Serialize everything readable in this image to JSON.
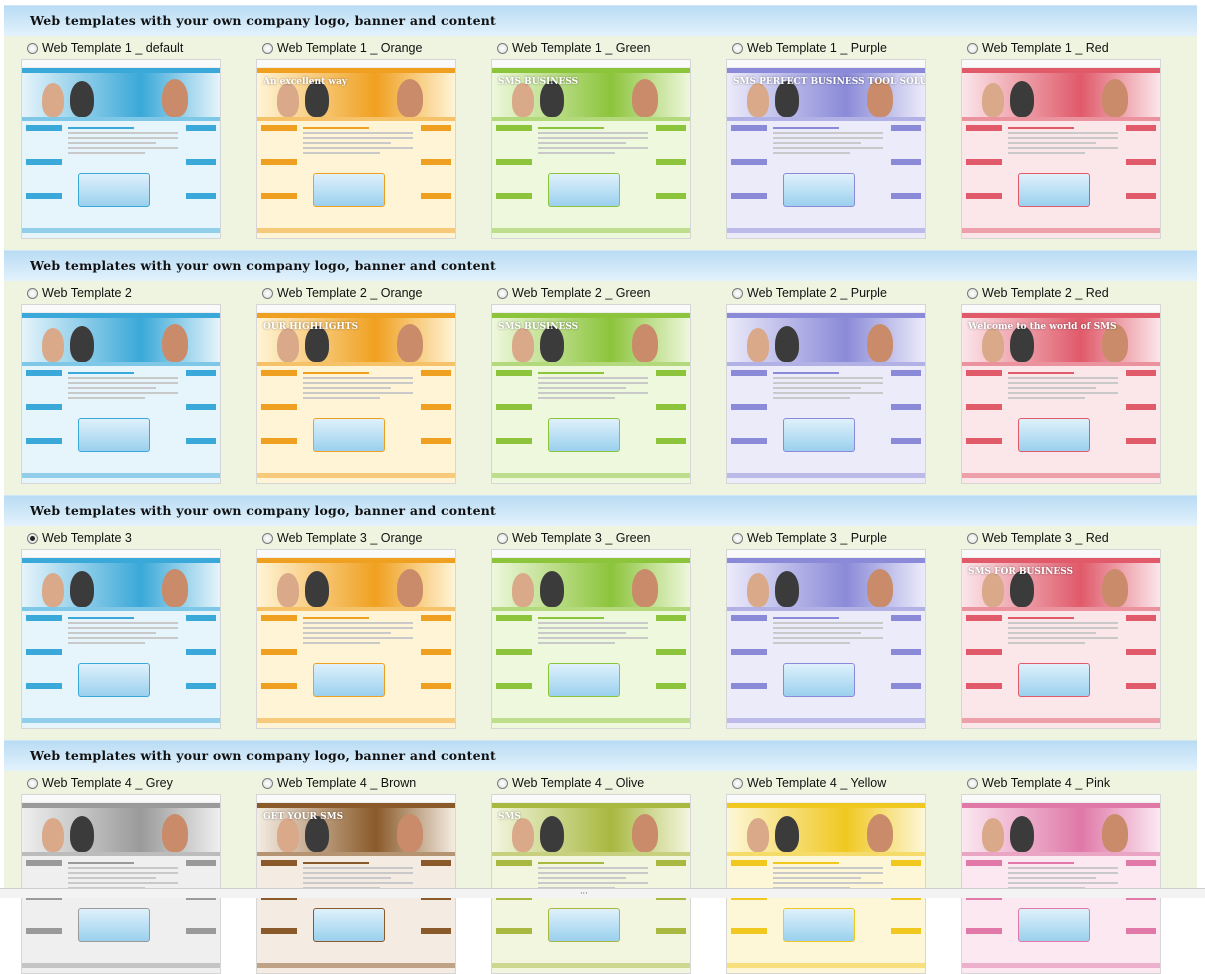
{
  "sections": [
    {
      "title": "Web templates with your own company logo, banner and content",
      "options": [
        {
          "label": "Web Template 1 _ default",
          "checked": false,
          "accent": "#3aa8d8",
          "accent2": "#e6f4fb",
          "banner_text": ""
        },
        {
          "label": "Web Template 1 _ Orange",
          "checked": false,
          "accent": "#f0a020",
          "accent2": "#fff4d6",
          "banner_text": "An excellent way"
        },
        {
          "label": "Web Template 1 _ Green",
          "checked": false,
          "accent": "#8cc43c",
          "accent2": "#eef8dc",
          "banner_text": "SMS BUSINESS"
        },
        {
          "label": "Web Template 1 _ Purple",
          "checked": false,
          "accent": "#8a8ad8",
          "accent2": "#ecebfa",
          "banner_text": "SMS PERFECT BUSINESS TOOL SOLUTION"
        },
        {
          "label": "Web Template 1 _ Red",
          "checked": false,
          "accent": "#e05a6a",
          "accent2": "#fbe6ea",
          "banner_text": ""
        }
      ]
    },
    {
      "title": "Web templates with your own company logo, banner and content",
      "options": [
        {
          "label": "Web Template 2",
          "checked": false,
          "accent": "#3aa8d8",
          "accent2": "#e6f4fb",
          "banner_text": ""
        },
        {
          "label": "Web Template 2 _ Orange",
          "checked": false,
          "accent": "#f0a020",
          "accent2": "#fff4d6",
          "banner_text": "OUR HIGHLIGHTS"
        },
        {
          "label": "Web Template 2 _ Green",
          "checked": false,
          "accent": "#8cc43c",
          "accent2": "#eef8dc",
          "banner_text": "SMS BUSINESS"
        },
        {
          "label": "Web Template 2 _ Purple",
          "checked": false,
          "accent": "#8a8ad8",
          "accent2": "#ecebfa",
          "banner_text": ""
        },
        {
          "label": "Web Template 2 _ Red",
          "checked": false,
          "accent": "#e05a6a",
          "accent2": "#fbe6ea",
          "banner_text": "Welcome to the world of SMS"
        }
      ]
    },
    {
      "title": "Web templates with your own company logo, banner and content",
      "options": [
        {
          "label": "Web Template 3",
          "checked": true,
          "accent": "#3aa8d8",
          "accent2": "#e6f4fb",
          "banner_text": ""
        },
        {
          "label": "Web Template 3 _ Orange",
          "checked": false,
          "accent": "#f0a020",
          "accent2": "#fff4d6",
          "banner_text": ""
        },
        {
          "label": "Web Template 3 _ Green",
          "checked": false,
          "accent": "#8cc43c",
          "accent2": "#eef8dc",
          "banner_text": ""
        },
        {
          "label": "Web Template 3 _ Purple",
          "checked": false,
          "accent": "#8a8ad8",
          "accent2": "#ecebfa",
          "banner_text": ""
        },
        {
          "label": "Web Template 3 _ Red",
          "checked": false,
          "accent": "#e05a6a",
          "accent2": "#fbe6ea",
          "banner_text": "SMS FOR BUSINESS"
        }
      ]
    },
    {
      "title": "Web templates with your own company logo, banner and content",
      "options": [
        {
          "label": "Web Template 4 _ Grey",
          "checked": false,
          "accent": "#9a9a9a",
          "accent2": "#efefef",
          "banner_text": ""
        },
        {
          "label": "Web Template 4 _ Brown",
          "checked": false,
          "accent": "#8a5a2a",
          "accent2": "#f4ece2",
          "banner_text": "GET YOUR SMS"
        },
        {
          "label": "Web Template 4 _ Olive",
          "checked": false,
          "accent": "#a8b840",
          "accent2": "#f3f6df",
          "banner_text": "SMS"
        },
        {
          "label": "Web Template 4 _ Yellow",
          "checked": false,
          "accent": "#f0c820",
          "accent2": "#fdf7d8",
          "banner_text": ""
        },
        {
          "label": "Web Template 4 _ Pink",
          "checked": false,
          "accent": "#e078a8",
          "accent2": "#fbe8f1",
          "banner_text": ""
        }
      ]
    }
  ],
  "status_bar": {
    "grip": "···"
  }
}
